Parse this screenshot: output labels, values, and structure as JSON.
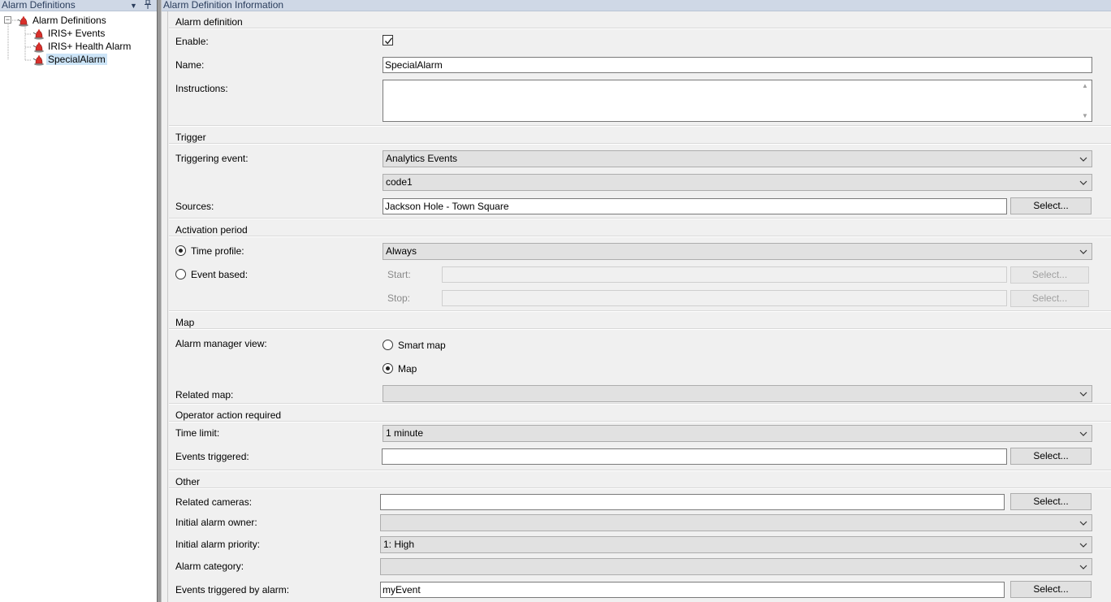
{
  "left_pane": {
    "title": "Alarm Definitions",
    "tree": {
      "root_label": "Alarm Definitions",
      "items": [
        {
          "label": "IRIS+ Events"
        },
        {
          "label": "IRIS+ Health Alarm"
        },
        {
          "label": "SpecialAlarm",
          "selected": true
        }
      ]
    }
  },
  "right_pane": {
    "title": "Alarm Definition Information"
  },
  "alarm_definition": {
    "section": "Alarm definition",
    "enable_label": "Enable:",
    "enable_checked": true,
    "name_label": "Name:",
    "name_value": "SpecialAlarm",
    "instructions_label": "Instructions:",
    "instructions_value": ""
  },
  "trigger": {
    "section": "Trigger",
    "triggering_event_label": "Triggering event:",
    "triggering_event_value": "Analytics Events",
    "triggering_event_sub_value": "code1",
    "sources_label": "Sources:",
    "sources_value": "Jackson Hole - Town Square",
    "select_label": "Select..."
  },
  "activation_period": {
    "section": "Activation period",
    "time_profile_label": "Time profile:",
    "time_profile_value": "Always",
    "event_based_label": "Event based:",
    "start_label": "Start:",
    "stop_label": "Stop:",
    "select_label": "Select...",
    "selected_option": "time_profile"
  },
  "map": {
    "section": "Map",
    "alarm_manager_view_label": "Alarm manager view:",
    "smart_map_label": "Smart map",
    "map_label": "Map",
    "selected_option": "map",
    "related_map_label": "Related map:",
    "related_map_value": ""
  },
  "operator_action": {
    "section": "Operator action required",
    "time_limit_label": "Time limit:",
    "time_limit_value": "1 minute",
    "events_triggered_label": "Events triggered:",
    "events_triggered_value": "",
    "select_label": "Select..."
  },
  "other": {
    "section": "Other",
    "related_cameras_label": "Related cameras:",
    "related_cameras_value": "",
    "initial_owner_label": "Initial alarm owner:",
    "initial_owner_value": "",
    "initial_priority_label": "Initial alarm priority:",
    "initial_priority_value": "1: High",
    "alarm_category_label": "Alarm category:",
    "alarm_category_value": "",
    "events_by_alarm_label": "Events triggered by alarm:",
    "events_by_alarm_value": "myEvent",
    "select_label": "Select..."
  },
  "colors": {
    "header_bg": "#cfd8e6",
    "selection_bg": "#cce4f7",
    "form_bg": "#f0f0f0"
  },
  "icons": {
    "tree_item_icon": "alarm-bell-icon",
    "dropdown_icon": "chevron-down-icon",
    "pin_icon": "pin-icon"
  }
}
